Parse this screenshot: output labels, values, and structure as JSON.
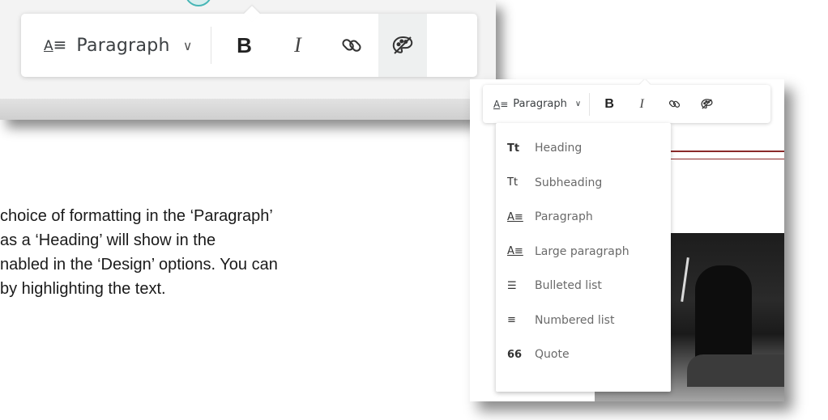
{
  "zoomed_toolbar": {
    "paragraph_label": "Paragraph",
    "bold_label": "B",
    "italic_label": "I",
    "icons": [
      "paragraph-style-icon",
      "chevron-down-icon",
      "link-icon",
      "palette-icon"
    ]
  },
  "body_text": {
    "lines": [
      "choice of formatting in the ‘Paragraph’",
      " as a ‘Heading’ will show in the",
      "nabled in the ‘Design’ options. You can",
      "by highlighting the text."
    ]
  },
  "toolbar": {
    "paragraph_label": "Paragraph",
    "bold_label": "B",
    "italic_label": "I"
  },
  "dropdown": {
    "items": [
      {
        "icon_text": "Tt",
        "icon": "heading-icon",
        "label": "Heading"
      },
      {
        "icon_text": "Tt",
        "icon": "subheading-icon",
        "label": "Subheading"
      },
      {
        "icon_text": "A≡",
        "icon": "paragraph-icon",
        "label": "Paragraph"
      },
      {
        "icon_text": "A≡",
        "icon": "large-paragraph-icon",
        "label": "Large paragraph"
      },
      {
        "icon_text": "☰",
        "icon": "bulleted-list-icon",
        "label": "Bulleted list"
      },
      {
        "icon_text": "≡",
        "icon": "numbered-list-icon",
        "label": "Numbered list"
      },
      {
        "icon_text": "66",
        "icon": "quote-icon",
        "label": "Quote"
      }
    ]
  },
  "colors": {
    "accent_red": "#8b2a2a",
    "toolbar_text": "#3c4043",
    "active_button_bg": "#eef0f0",
    "avatar_ring": "#46b6b6"
  }
}
